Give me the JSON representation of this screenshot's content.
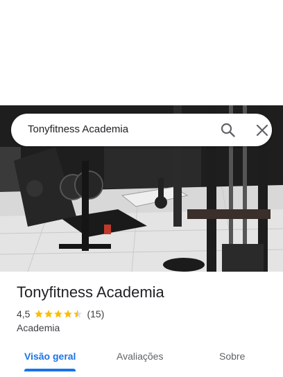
{
  "search": {
    "query": "Tonyfitness Academia"
  },
  "icons": {
    "search": "search-icon",
    "close": "close-icon",
    "star": "star-icon"
  },
  "place": {
    "name": "Tonyfitness Academia",
    "rating": "4,5",
    "rating_stars": 4.5,
    "review_count": "(15)",
    "category": "Academia"
  },
  "tabs": [
    {
      "label": "Visão geral",
      "active": true
    },
    {
      "label": "Avaliações",
      "active": false
    },
    {
      "label": "Sobre",
      "active": false
    }
  ],
  "colors": {
    "accent": "#1a73e8",
    "star": "#fbbc04",
    "text": "#202124",
    "muted": "#3c4043"
  }
}
